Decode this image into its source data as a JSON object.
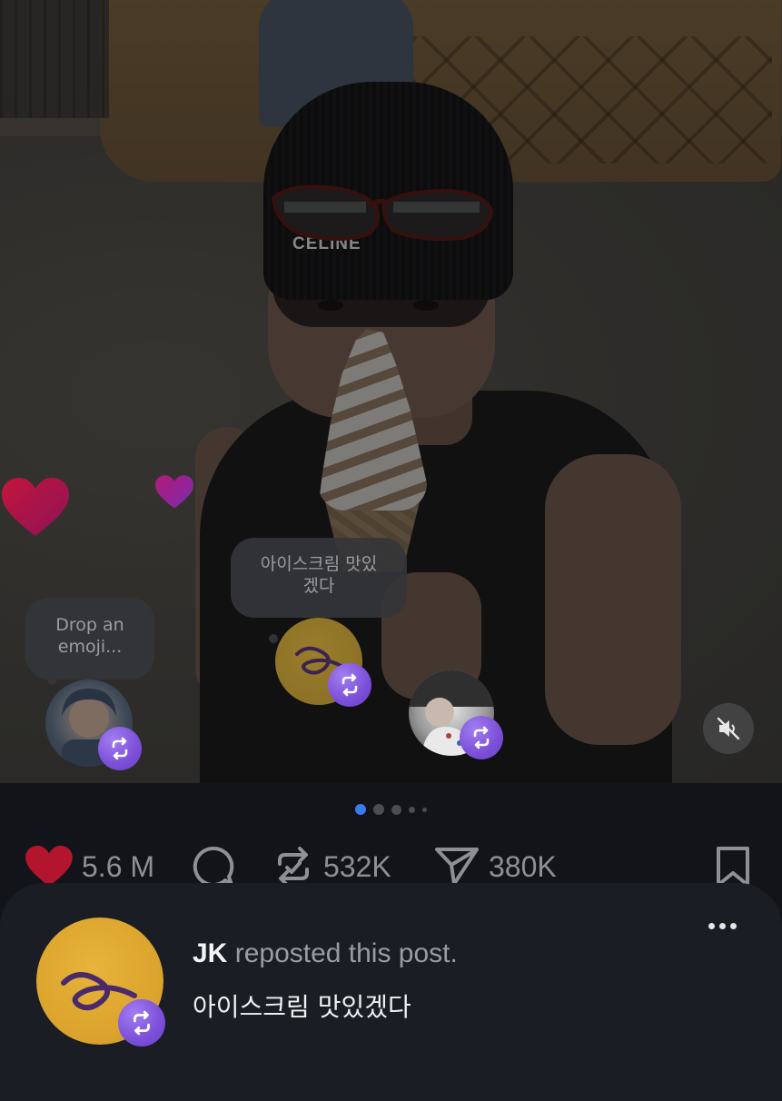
{
  "media": {
    "beanie_text": "CELINE",
    "bubble_left": {
      "line1": "Drop an",
      "line2": "emoji..."
    },
    "bubble_center": {
      "line1": "아이스크림 맛있",
      "line2": "겠다"
    },
    "mute_icon": "speaker-muted-icon",
    "heart_icon": "heart-icon",
    "repost_icon": "repost-icon"
  },
  "pagination": {
    "count": 5,
    "active": 0
  },
  "actions": {
    "likes": "5.6 M",
    "reposts": "532K",
    "shares": "380K",
    "icons": [
      "heart-icon",
      "comment-icon",
      "repost-icon",
      "send-icon",
      "bookmark-icon"
    ]
  },
  "sheet": {
    "user": "JK",
    "action_text": "reposted this post.",
    "caption": "아이스크림 맛있겠다",
    "more_icon": "more-icon"
  },
  "colors": {
    "background": "#121419",
    "sheet": "#1a1d24",
    "like": "#c8102e",
    "repost_badge": "#7b4fd8",
    "avatar_yellow": "#d9a22c",
    "pagination_active": "#3b7bf0"
  }
}
